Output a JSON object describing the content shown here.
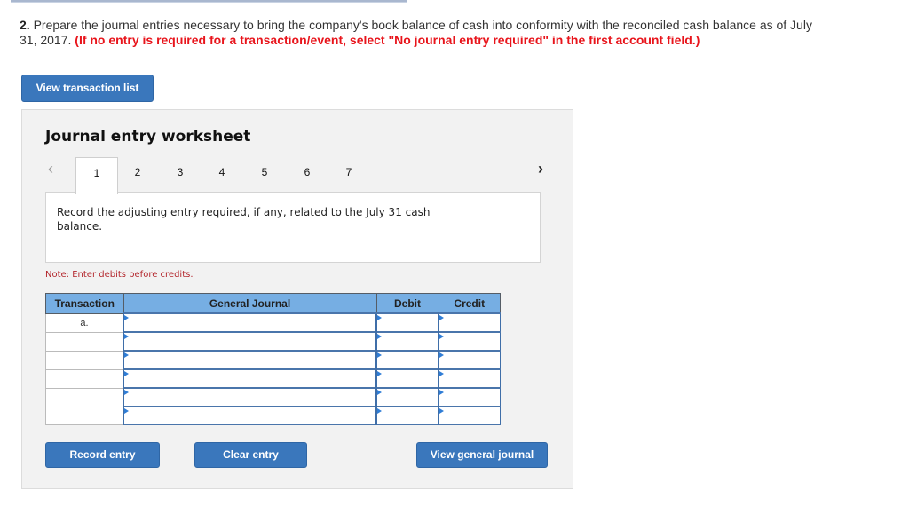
{
  "question": {
    "number": "2.",
    "text": "Prepare the journal entries necessary to bring the company's book balance of cash into conformity with the reconciled cash balance as of July 31, 2017.",
    "instruction": "(If no entry is required for a transaction/event, select \"No journal entry required\" in the first account field.)"
  },
  "buttons": {
    "view_transaction_list": "View transaction list",
    "record_entry": "Record entry",
    "clear_entry": "Clear entry",
    "view_general_journal": "View general journal"
  },
  "worksheet": {
    "title": "Journal entry worksheet",
    "prev_icon": "‹",
    "next_icon": "›",
    "tabs": [
      "1",
      "2",
      "3",
      "4",
      "5",
      "6",
      "7"
    ],
    "active_tab": "1",
    "prompt": "Record the adjusting entry required, if any, related to the July 31 cash balance.",
    "note": "Note: Enter debits before credits."
  },
  "table": {
    "headers": [
      "Transaction",
      "General Journal",
      "Debit",
      "Credit"
    ],
    "rows": [
      {
        "transaction": "a.",
        "account": "",
        "debit": "",
        "credit": ""
      },
      {
        "transaction": "",
        "account": "",
        "debit": "",
        "credit": ""
      },
      {
        "transaction": "",
        "account": "",
        "debit": "",
        "credit": ""
      },
      {
        "transaction": "",
        "account": "",
        "debit": "",
        "credit": ""
      },
      {
        "transaction": "",
        "account": "",
        "debit": "",
        "credit": ""
      },
      {
        "transaction": "",
        "account": "",
        "debit": "",
        "credit": ""
      }
    ]
  },
  "colors": {
    "button_blue": "#3a77bc",
    "header_blue": "#76aee3",
    "instruction_red": "#e8141b",
    "note_red": "#b3262c"
  }
}
